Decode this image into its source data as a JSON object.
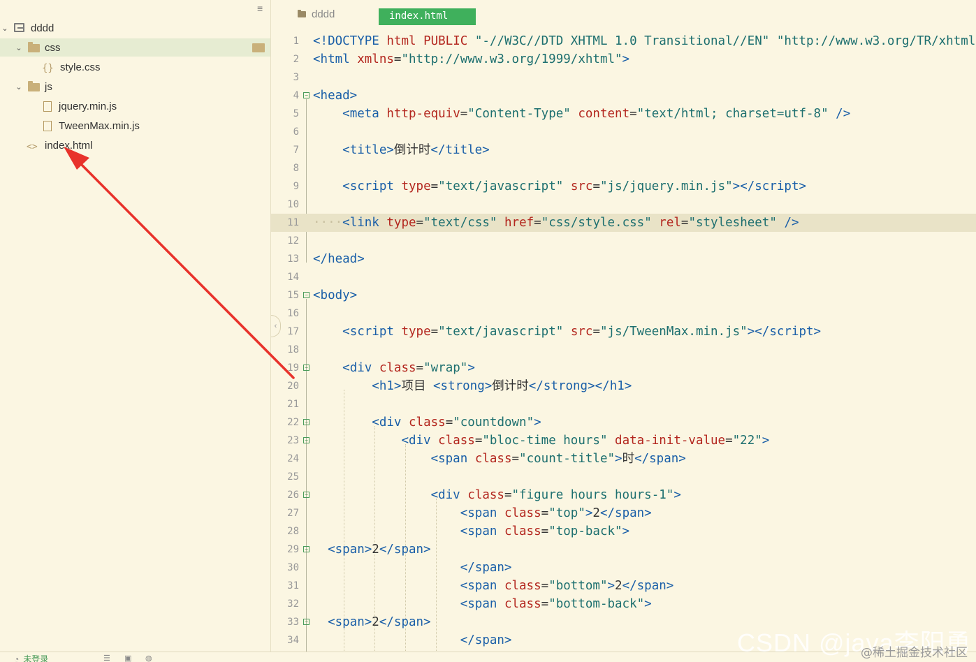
{
  "sidebar": {
    "project": "dddd",
    "items": [
      {
        "label": "css"
      },
      {
        "label": "style.css"
      },
      {
        "label": "js"
      },
      {
        "label": "jquery.min.js"
      },
      {
        "label": "TweenMax.min.js"
      },
      {
        "label": "index.html"
      }
    ]
  },
  "tabs": [
    {
      "label": "dddd"
    },
    {
      "label": "index.html"
    }
  ],
  "code": {
    "lines": [
      "1",
      "2",
      "3",
      "4",
      "5",
      "6",
      "7",
      "8",
      "9",
      "10",
      "11",
      "12",
      "13",
      "14",
      "15",
      "16",
      "17",
      "18",
      "19",
      "20",
      "21",
      "22",
      "23",
      "24",
      "25",
      "26",
      "27",
      "28",
      "29",
      "30",
      "31",
      "32",
      "33",
      "34"
    ]
  },
  "statusbar": {
    "login": "未登录"
  },
  "watermark": {
    "csdn": "CSDN @java李阳勇",
    "juejin": "@稀土掘金技术社区"
  },
  "colors": {
    "tag": "#1a5fa8",
    "attr": "#b3261e",
    "string": "#1d6f6f",
    "active_tab": "#3fb05c",
    "annotation_arrow": "#e8322b"
  }
}
